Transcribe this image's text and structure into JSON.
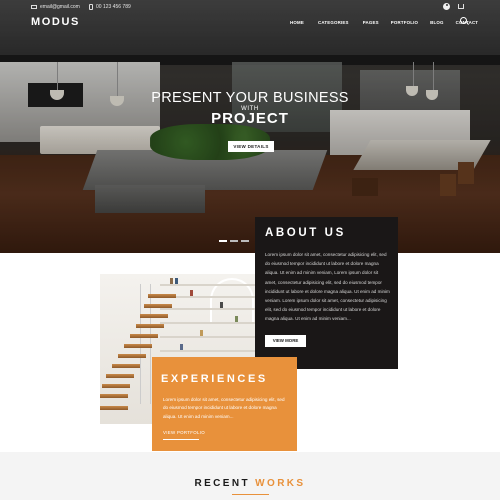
{
  "header": {
    "email": "email@gmail.com",
    "phone": "00 123 456 789",
    "logo": "MODUS",
    "nav": [
      "HOME",
      "CATEGORIES",
      "PAGES",
      "PORTFOLIO",
      "BLOG",
      "CONTACT"
    ],
    "icons": [
      "mail-icon",
      "phone-icon",
      "user-icon",
      "cart-icon",
      "search-icon"
    ]
  },
  "hero": {
    "line1": "PRESENT YOUR BUSINESS",
    "with": "WITH",
    "line2": "PROJECT",
    "button": "VIEW DETAILS",
    "slides": 3,
    "active_slide": 1
  },
  "about": {
    "title": "ABOUT US",
    "text": "Lorem ipsum dolor sit amet, consectetur adipisicing elit, sed do eiusmod tempor incididunt ut labore et dolore magna aliqua. Ut enim ad minim veniam, Lorem ipsum dolor sit amet, consectetur adipisicing elit, sed do eiusmod tempor incididunt ut labore et dolore magna aliqua. Ut enim ad minim veniam. Lorem ipsum dolor sit amet, consectetur adipisicing elit, sed do eiusmod tempor incididunt ut labore et dolore magna aliqua. Ut enim ad minim veniam...",
    "button": "VIEW MORE",
    "bg_color": "#1a1717"
  },
  "experiences": {
    "title": "EXPERIENCES",
    "text": "Lorem ipsum dolor sit amet, consectetur adipisicing elit, sed do eiusmod tempor incididunt ut labore et dolore magna aliqua. Ut enim ad minim veniam...",
    "link": "VIEW PORTFOLIO",
    "bg_color": "#e8913b"
  },
  "works": {
    "title_dark": "RECENT ",
    "title_accent": "WORKS",
    "accent_color": "#e8913b"
  }
}
